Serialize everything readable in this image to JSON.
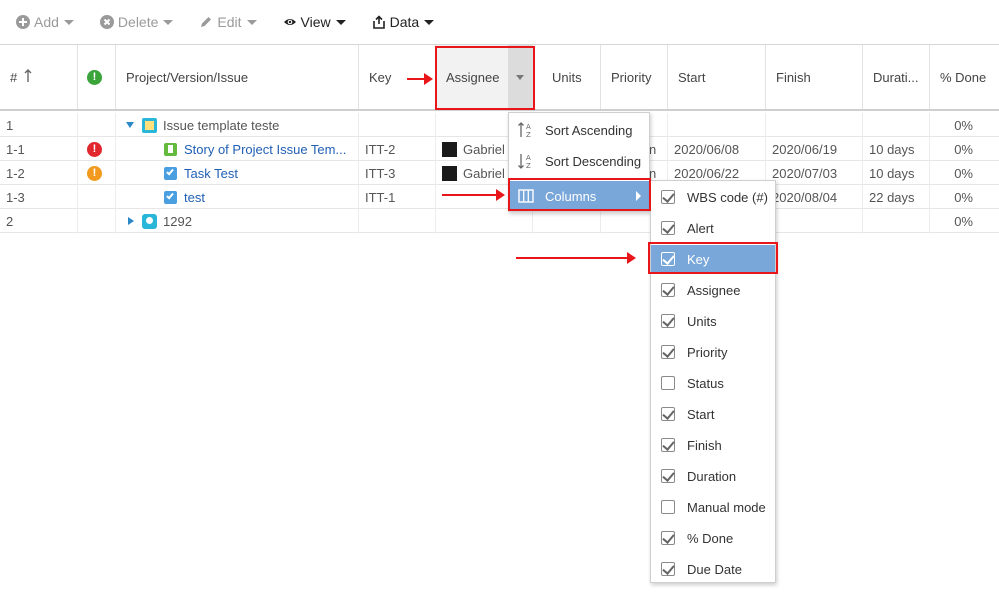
{
  "toolbar": {
    "add_label": "Add",
    "delete_label": "Delete",
    "edit_label": "Edit",
    "view_label": "View",
    "data_label": "Data"
  },
  "columns": {
    "wbs": "#",
    "alert": "",
    "project": "Project/Version/Issue",
    "key": "Key",
    "assignee": "Assignee",
    "units": "Units",
    "priority": "Priority",
    "start": "Start",
    "finish": "Finish",
    "duration": "Durati...",
    "done": "% Done"
  },
  "rows": [
    {
      "wbs": "1",
      "alert": "",
      "name": "Issue template teste",
      "key": "",
      "assignee": "",
      "priority": "",
      "start": "",
      "finish": "",
      "duration": "",
      "done": "0%"
    },
    {
      "wbs": "1-1",
      "alert": "!",
      "name": "Story of Project Issue Tem...",
      "key": "ITT-2",
      "assignee": "Gabriel",
      "priority": "n",
      "start": "2020/06/08",
      "finish": "2020/06/19",
      "duration": "10 days",
      "done": "0%"
    },
    {
      "wbs": "1-2",
      "alert": "!",
      "name": "Task Test",
      "key": "ITT-3",
      "assignee": "Gabriel",
      "priority": "n",
      "start": "2020/06/22",
      "finish": "2020/07/03",
      "duration": "10 days",
      "done": "0%"
    },
    {
      "wbs": "1-3",
      "alert": "",
      "name": "test",
      "key": "ITT-1",
      "assignee": "",
      "priority": "",
      "start": "",
      "finish": "2020/08/04",
      "duration": "22 days",
      "done": "0%"
    },
    {
      "wbs": "2",
      "alert": "",
      "name": "1292",
      "key": "",
      "assignee": "",
      "priority": "",
      "start": "",
      "finish": "",
      "duration": "",
      "done": "0%"
    }
  ],
  "colors": {
    "alert_red": "#e0282e",
    "alert_orange": "#f29a1f",
    "alert_green": "#3aa43a",
    "highlight": "#e8161b",
    "menu_selected": "#7aa7d9",
    "link": "#1f5fb5"
  },
  "header_menu": {
    "sort_asc": "Sort Ascending",
    "sort_desc": "Sort Descending",
    "columns": "Columns"
  },
  "columns_menu": [
    {
      "label": "WBS code (#)",
      "checked": true
    },
    {
      "label": "Alert",
      "checked": true
    },
    {
      "label": "Key",
      "checked": true
    },
    {
      "label": "Assignee",
      "checked": true
    },
    {
      "label": "Units",
      "checked": true
    },
    {
      "label": "Priority",
      "checked": true
    },
    {
      "label": "Status",
      "checked": false
    },
    {
      "label": "Start",
      "checked": true
    },
    {
      "label": "Finish",
      "checked": true
    },
    {
      "label": "Duration",
      "checked": true
    },
    {
      "label": "Manual mode",
      "checked": false
    },
    {
      "label": "% Done",
      "checked": true
    },
    {
      "label": "Due Date",
      "checked": true
    }
  ]
}
